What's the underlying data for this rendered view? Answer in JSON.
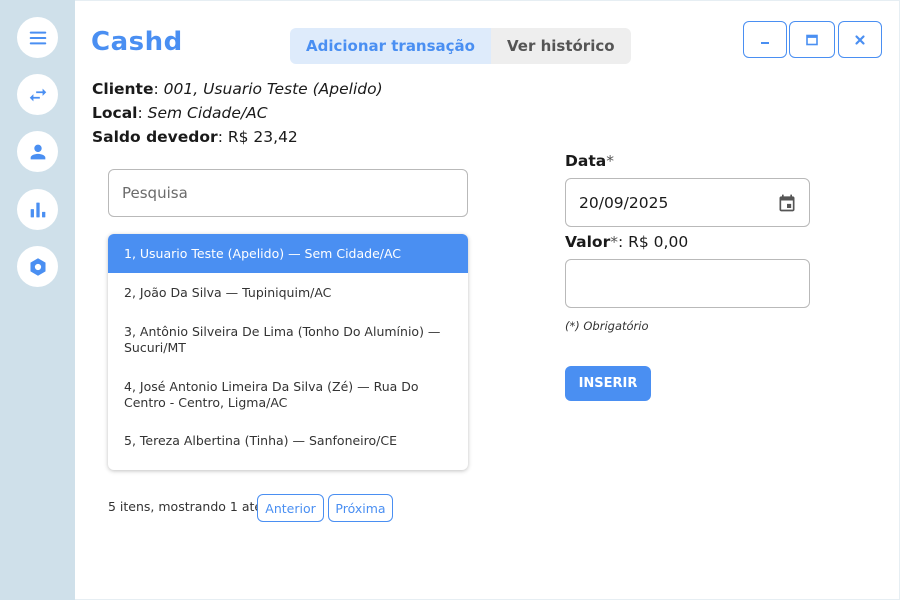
{
  "app": {
    "title": "Cashd"
  },
  "sidebar": {
    "items": [
      {
        "icon": "menu-icon"
      },
      {
        "icon": "swap-arrows-icon"
      },
      {
        "icon": "person-icon"
      },
      {
        "icon": "bar-chart-icon"
      },
      {
        "icon": "hexagon-settings-icon"
      }
    ]
  },
  "tabs": [
    {
      "label": "Adicionar transação",
      "active": true
    },
    {
      "label": "Ver histórico",
      "active": false
    }
  ],
  "window_controls": {
    "minimize_icon": "minimize-icon",
    "maximize_icon": "maximize-icon",
    "close_icon": "close-icon"
  },
  "client_info": {
    "cliente_label": "Cliente",
    "cliente_value": "001, Usuario Teste (Apelido)",
    "local_label": "Local",
    "local_value": "Sem Cidade/AC",
    "saldo_label": "Saldo devedor",
    "saldo_value": "R$ 23,42"
  },
  "search": {
    "placeholder": "Pesquisa",
    "value": ""
  },
  "client_list": [
    {
      "text": "1, Usuario Teste (Apelido) — Sem Cidade/AC",
      "selected": true
    },
    {
      "text": "2, João Da Silva — Tupiniquim/AC",
      "selected": false
    },
    {
      "text": "3, Antônio Silveira De Lima (Tonho Do Alumínio) — Sucuri/MT",
      "selected": false
    },
    {
      "text": "4, José Antonio Limeira Da Silva (Zé) — Rua Do Centro - Centro, Ligma/AC",
      "selected": false
    },
    {
      "text": "5, Tereza Albertina (Tinha) — Sanfoneiro/CE",
      "selected": false
    }
  ],
  "pagination": {
    "status": "5 itens, mostrando 1 até 5",
    "prev_label": "Anterior",
    "next_label": "Próxima"
  },
  "form": {
    "data_label": "Data",
    "data_value": "20/09/2025",
    "valor_label": "Valor",
    "valor_display": "R$ 0,00",
    "valor_value": "",
    "required_marker": "*",
    "required_note": "(*) Obrigatório",
    "submit_label": "INSERIR"
  },
  "colors": {
    "accent": "#4a8ff2",
    "sidebar_bg": "#cfe0ea",
    "tab_active_bg": "#deebfb",
    "tab_inactive_bg": "#eeeeee"
  }
}
